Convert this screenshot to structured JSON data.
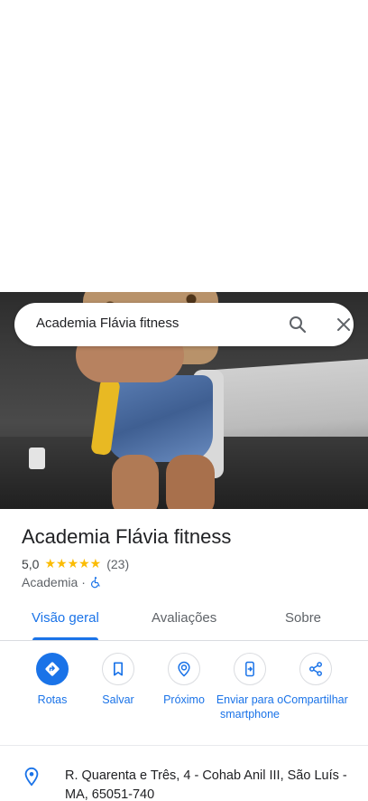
{
  "search": {
    "query": "Academia Flávia fitness"
  },
  "place": {
    "name": "Academia Flávia fitness",
    "rating": "5,0",
    "stars": "★★★★★",
    "reviews": "(23)",
    "category": "Academia",
    "separator": "·"
  },
  "tabs": [
    {
      "label": "Visão geral"
    },
    {
      "label": "Avaliações"
    },
    {
      "label": "Sobre"
    }
  ],
  "actions": [
    {
      "label": "Rotas",
      "icon": "directions-icon"
    },
    {
      "label": "Salvar",
      "icon": "bookmark-icon"
    },
    {
      "label": "Próximo",
      "icon": "nearby-icon"
    },
    {
      "label": "Enviar para o smartphone",
      "icon": "send-to-phone-icon"
    },
    {
      "label": "Compartilhar",
      "icon": "share-icon"
    }
  ],
  "address": {
    "text": "R. Quarenta e Três, 4 - Cohab Anil III, São Luís - MA, 65051-740"
  },
  "colors": {
    "accent": "#1a73e8",
    "star": "#fbbc04"
  }
}
